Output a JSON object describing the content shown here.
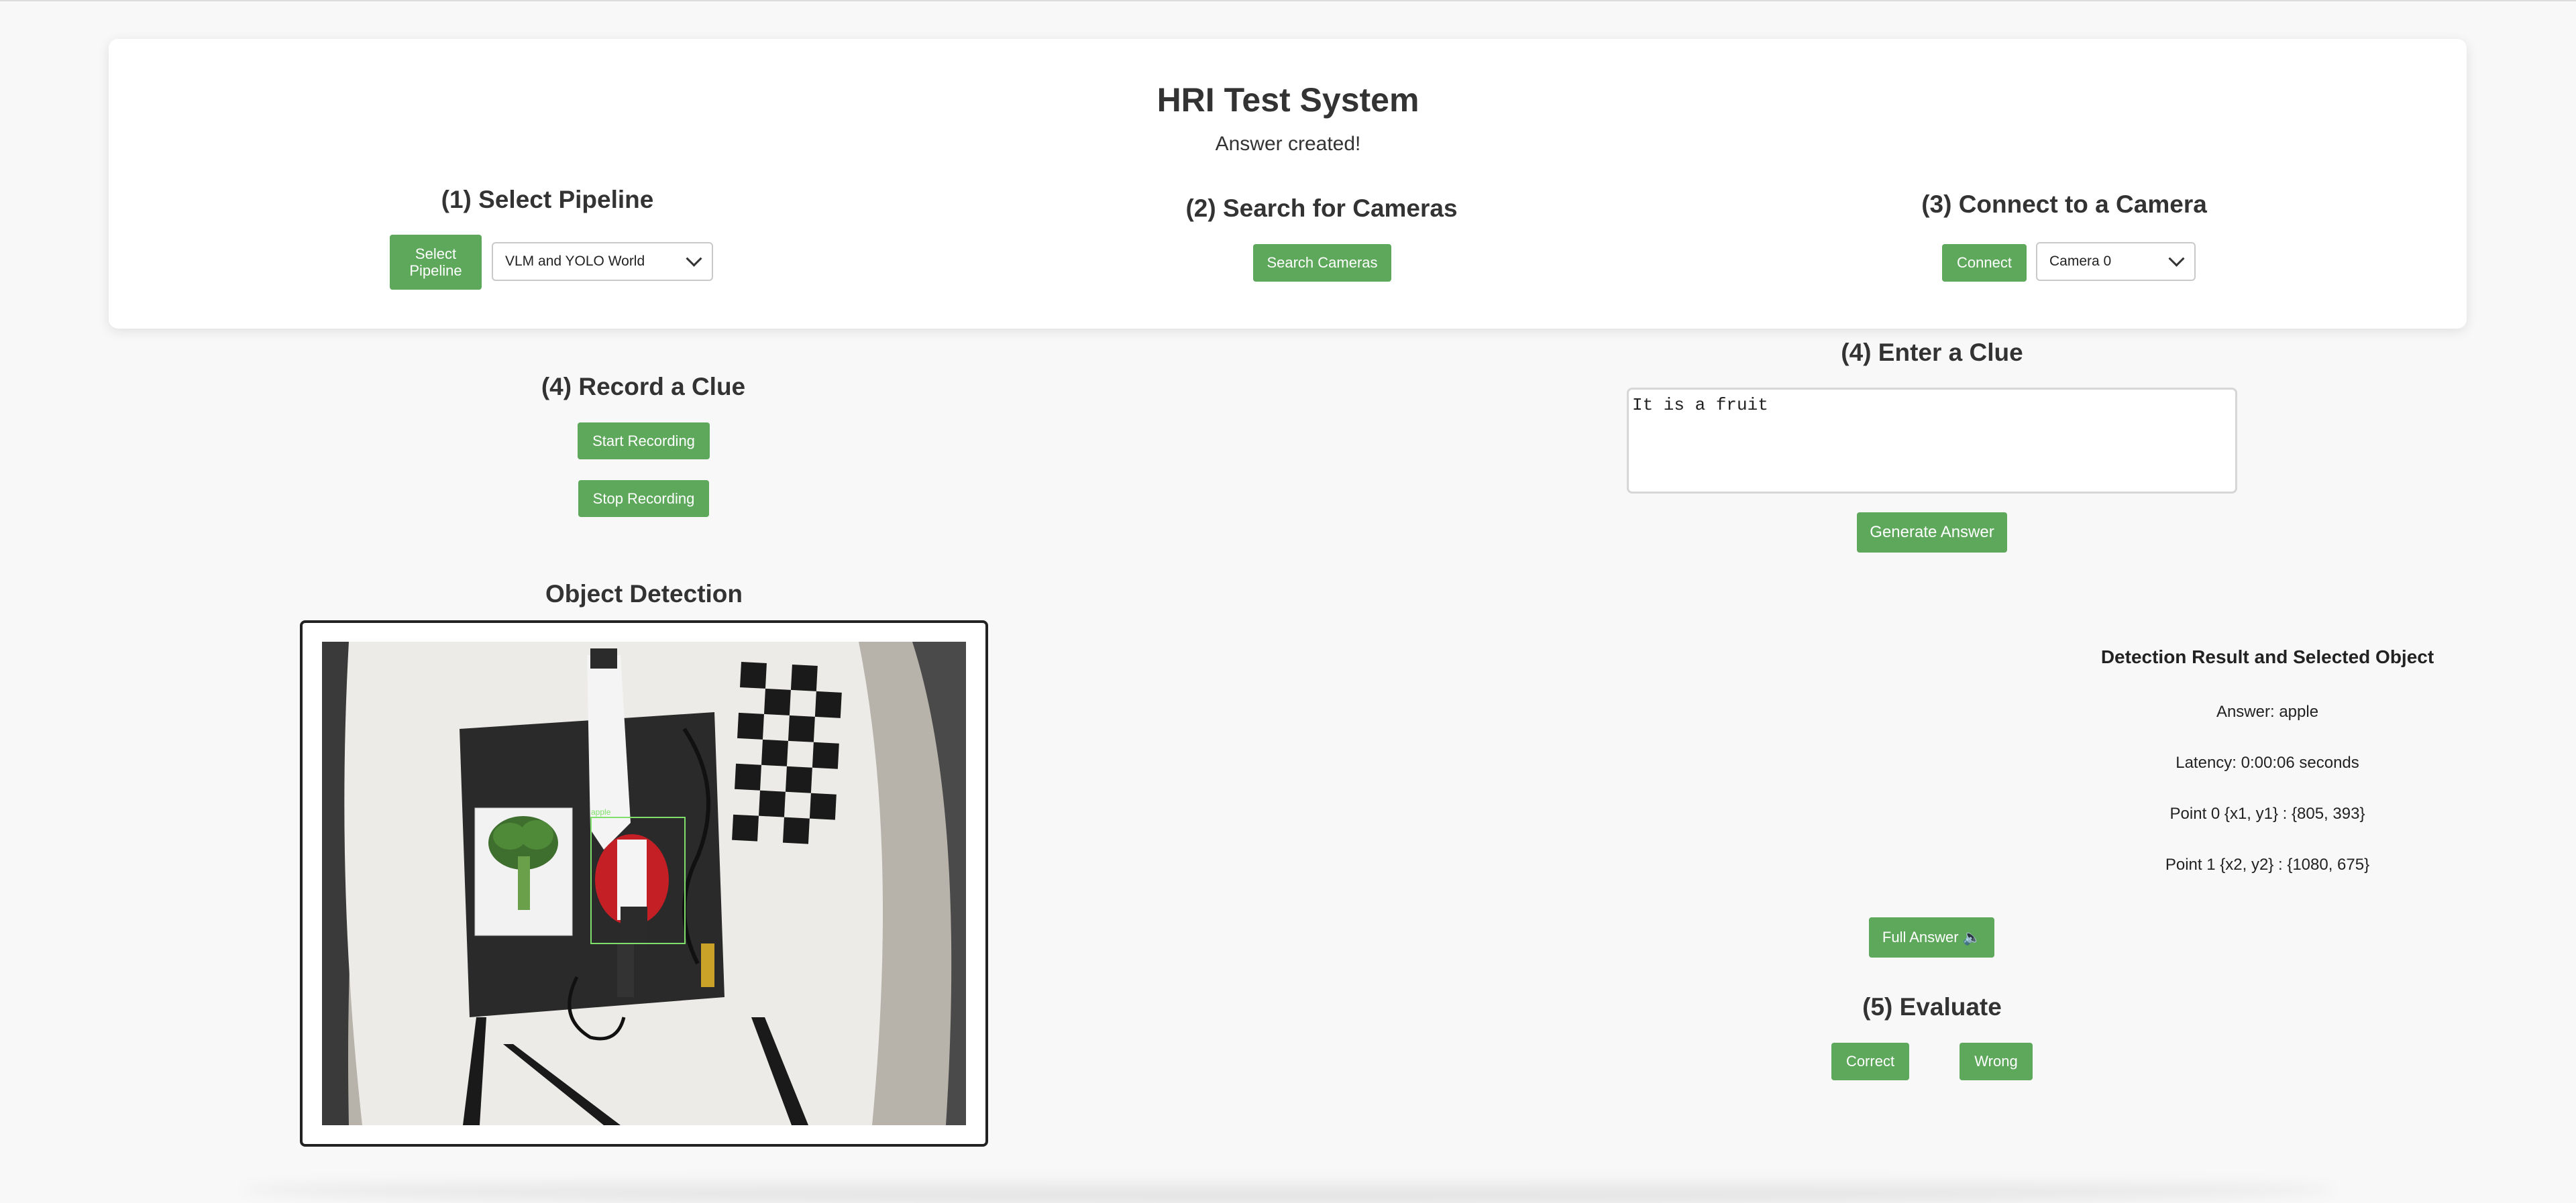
{
  "app": {
    "title": "HRI Test System",
    "status": "Answer created!"
  },
  "pipeline": {
    "heading": "(1) Select Pipeline",
    "button_label": "Select Pipeline",
    "selected": "VLM and YOLO World"
  },
  "cameras": {
    "heading": "(2) Search for Cameras",
    "button_label": "Search Cameras"
  },
  "connect": {
    "heading": "(3) Connect to a Camera",
    "button_label": "Connect",
    "selected": "Camera 0"
  },
  "record": {
    "heading": "(4) Record a Clue",
    "start_label": "Start Recording",
    "stop_label": "Stop Recording"
  },
  "clue": {
    "heading": "(4) Enter a Clue",
    "value": "It is a fruit",
    "generate_label": "Generate Answer"
  },
  "detection": {
    "heading": "Object Detection",
    "box_label": "apple"
  },
  "result": {
    "heading": "Detection Result and Selected Object",
    "answer": "Answer: apple",
    "latency": "Latency: 0:00:06 seconds",
    "point0": "Point 0 {x1, y1} : {805, 393}",
    "point1": "Point 1 {x2, y2} : {1080, 675}",
    "full_answer_label": "Full Answer 🔈"
  },
  "evaluate": {
    "heading": "(5) Evaluate",
    "correct_label": "Correct",
    "wrong_label": "Wrong"
  },
  "colors": {
    "button_green": "#5ea85c",
    "page_bg": "#f8f8f8",
    "card_bg": "#ffffff",
    "detection_box": "#7ee06a"
  },
  "icons": {
    "full_answer_icon": "speaker-icon",
    "select_chevron": "chevron-down-icon"
  }
}
